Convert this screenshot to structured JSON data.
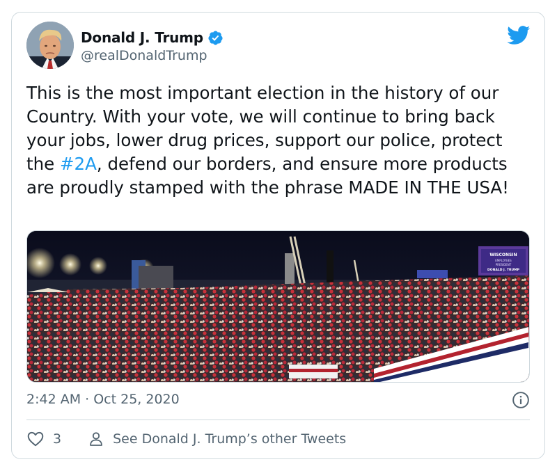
{
  "author": {
    "display_name": "Donald J. Trump",
    "handle": "@realDonaldTrump",
    "verified": true
  },
  "tweet": {
    "text_before_hashtag": "This is the most important election in the history of our Country. With your vote, we will continue to bring back your jobs, lower drug prices, support our police, protect the ",
    "hashtag": "#2A",
    "text_after_hashtag": ", defend our borders, and ensure more products are proudly stamped with the phrase MADE IN THE USA!"
  },
  "media": {
    "screen_text": [
      "WISCONSIN",
      "EMPLOYEES",
      "PRESIDENT",
      "DONALD J. TRUMP"
    ]
  },
  "timestamp": "2:42 AM · Oct 25, 2020",
  "actions": {
    "like_count": "3",
    "profile_link_label": "See Donald J. Trump’s other Tweets"
  },
  "colors": {
    "accent": "#1d9bf0",
    "secondary_text": "#536471",
    "border": "#cfd9de"
  },
  "icons": [
    "avatar",
    "verified-badge-icon",
    "twitter-bird-icon",
    "info-icon",
    "heart-icon",
    "person-icon"
  ]
}
